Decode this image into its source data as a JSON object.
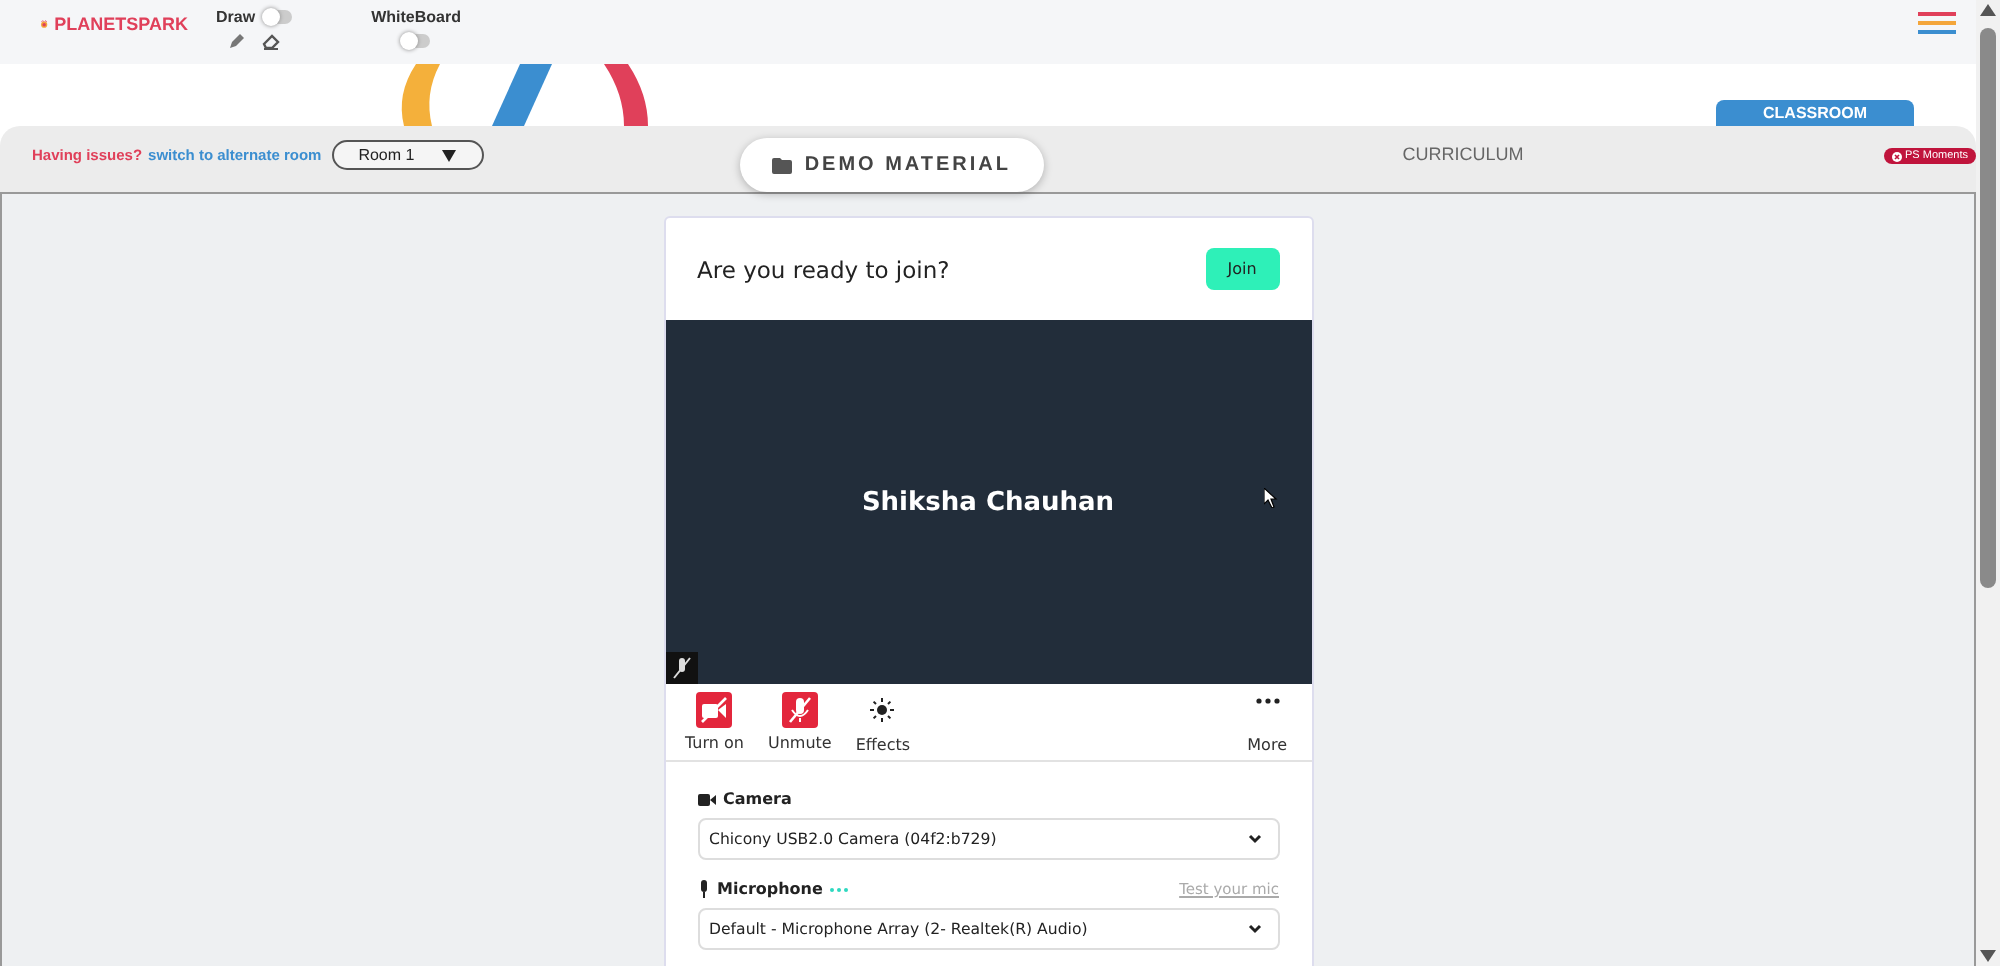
{
  "header": {
    "logo": "PLANETSPARK",
    "toggles": [
      {
        "label": "Draw",
        "on": false,
        "kind": "draw"
      },
      {
        "label": "WhiteBoard",
        "on": false,
        "kind": "plain"
      }
    ]
  },
  "room_bar": {
    "issue_text": "Having issues?",
    "switch_link": "switch to alternate room",
    "room_select": "Room 1"
  },
  "tabs": [
    {
      "label": "DEMO MATERIAL",
      "selected": true
    },
    {
      "label": "CURRICULUM",
      "selected": false
    }
  ],
  "classroom_tab": "CLASSROOM",
  "badge": "PS Moments",
  "join": {
    "title": "Are you ready to join?",
    "join_button": "Join",
    "participant": "Shiksha Chauhan",
    "controls": [
      {
        "label": "Turn on",
        "kind": "camera",
        "off": true
      },
      {
        "label": "Unmute",
        "kind": "mic",
        "off": true
      },
      {
        "label": "Effects",
        "kind": "effects"
      },
      {
        "label": "More",
        "kind": "more"
      }
    ],
    "camera": {
      "label": "Camera",
      "value": "Chicony USB2.0 Camera (04f2:b729)"
    },
    "microphone": {
      "label": "Microphone",
      "value": "Default - Microphone Array (2- Realtek(R) Audio)",
      "test_link": "Test your mic"
    }
  }
}
